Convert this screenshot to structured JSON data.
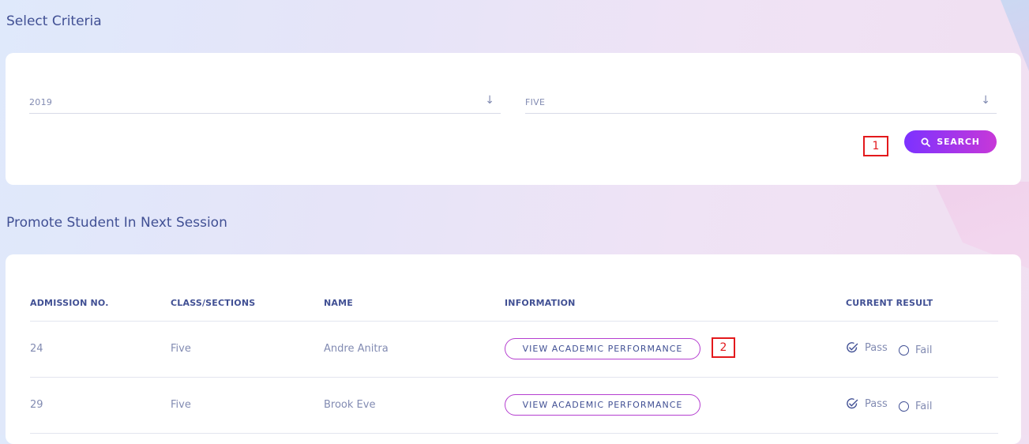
{
  "criteria": {
    "title": "Select Criteria",
    "session": "2019",
    "class": "FIVE",
    "search_label": "SEARCH"
  },
  "promote": {
    "title": "Promote Student In Next Session",
    "headers": [
      "ADMISSION NO.",
      "CLASS/SECTIONS",
      "NAME",
      "INFORMATION",
      "CURRENT RESULT"
    ],
    "rows": [
      {
        "admission": "24",
        "class": "Five",
        "name": "Andre Anitra",
        "info": "VIEW ACADEMIC PERFORMANCE",
        "pass": "Pass",
        "fail": "Fail"
      },
      {
        "admission": "29",
        "class": "Five",
        "name": "Brook Eve",
        "info": "VIEW ACADEMIC PERFORMANCE",
        "pass": "Pass",
        "fail": "Fail"
      }
    ]
  },
  "marks": [
    "1",
    "2"
  ],
  "icons": {
    "select_arrow": "arrow-down-icon",
    "search": "search-icon",
    "pass": "check-circle-icon",
    "fail": "radio-empty-icon"
  },
  "colors": {
    "primary": "#415094",
    "muted": "#828bb2",
    "accent_start": "#7c32ff",
    "accent_end": "#c738d8",
    "mark": "#e3191c"
  }
}
